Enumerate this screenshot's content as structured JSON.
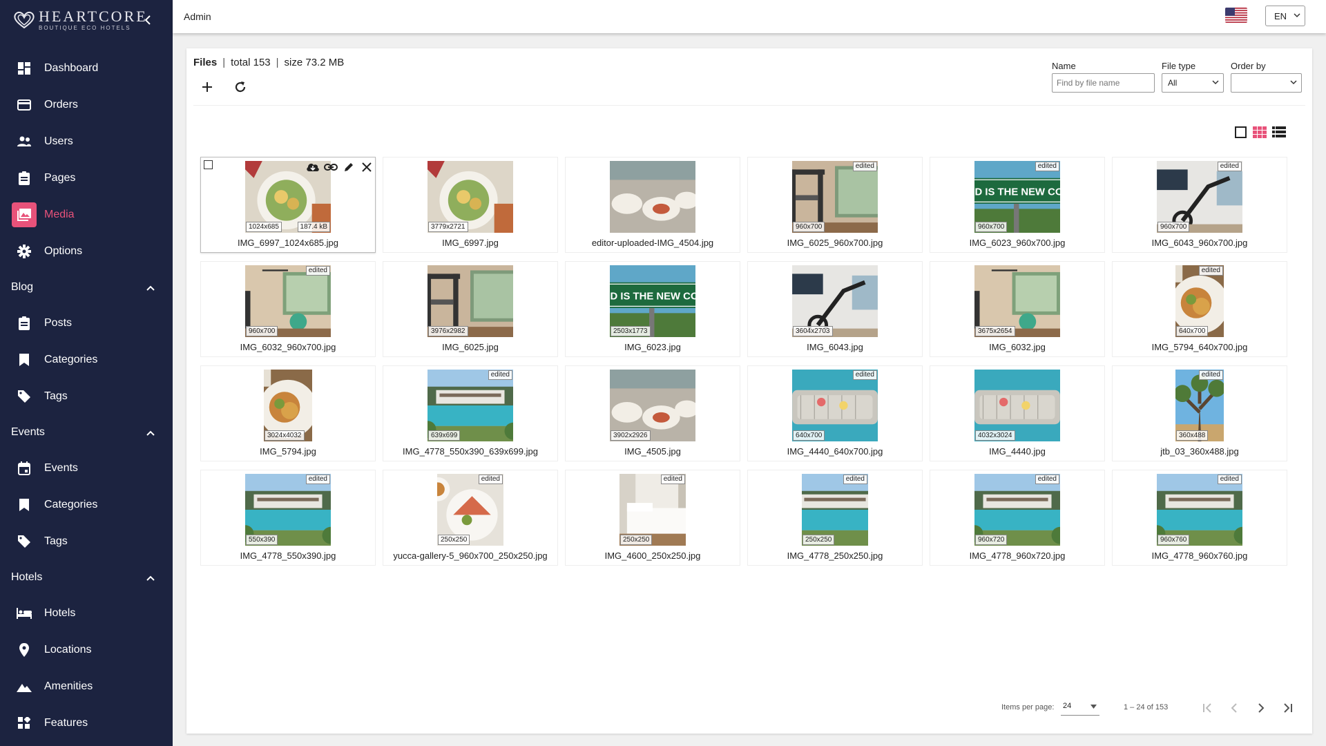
{
  "brand": {
    "name": "HEARTCORE",
    "tagline": "BOUTIQUE ECO HOTELS"
  },
  "topbar": {
    "title": "Admin",
    "language": "EN"
  },
  "sidebar": {
    "items": [
      {
        "label": "Dashboard",
        "icon": "dashboard-icon"
      },
      {
        "label": "Orders",
        "icon": "card-icon"
      },
      {
        "label": "Users",
        "icon": "users-icon"
      },
      {
        "label": "Pages",
        "icon": "page-icon"
      },
      {
        "label": "Media",
        "icon": "image-icon",
        "active": true
      },
      {
        "label": "Options",
        "icon": "gear-icon"
      }
    ],
    "blog": {
      "label": "Blog",
      "items": [
        {
          "label": "Posts"
        },
        {
          "label": "Categories"
        },
        {
          "label": "Tags"
        }
      ]
    },
    "events": {
      "label": "Events",
      "items": [
        {
          "label": "Events"
        },
        {
          "label": "Categories"
        },
        {
          "label": "Tags"
        }
      ]
    },
    "hotels": {
      "label": "Hotels",
      "items": [
        {
          "label": "Hotels"
        },
        {
          "label": "Locations"
        },
        {
          "label": "Amenities"
        },
        {
          "label": "Features"
        }
      ]
    }
  },
  "files": {
    "title": "Files",
    "total": "total 153",
    "sep": "|",
    "size": "size 73.2 MB"
  },
  "filters": {
    "name_label": "Name",
    "name_placeholder": "Find by file name",
    "type_label": "File type",
    "type_value": "All",
    "order_label": "Order by",
    "order_value": ""
  },
  "tiles": [
    {
      "name": "IMG_6997_1024x685.jpg",
      "dim": "1024x685",
      "size": "187.4 kB",
      "edited": false,
      "scene": "food"
    },
    {
      "name": "IMG_6997.jpg",
      "dim": "3779x2721",
      "edited": false,
      "scene": "food"
    },
    {
      "name": "editor-uploaded-IMG_4504.jpg",
      "dim": "",
      "edited": false,
      "scene": "table"
    },
    {
      "name": "IMG_6025_960x700.jpg",
      "dim": "960x700",
      "edited": true,
      "scene": "gym"
    },
    {
      "name": "IMG_6023_960x700.jpg",
      "dim": "960x700",
      "edited": true,
      "scene": "sign"
    },
    {
      "name": "IMG_6043_960x700.jpg",
      "dim": "960x700",
      "edited": true,
      "scene": "bike"
    },
    {
      "name": "IMG_6032_960x700.jpg",
      "dim": "960x700",
      "edited": true,
      "scene": "room"
    },
    {
      "name": "IMG_6025.jpg",
      "dim": "3976x2982",
      "edited": false,
      "scene": "gym"
    },
    {
      "name": "IMG_6023.jpg",
      "dim": "2503x1773",
      "edited": false,
      "scene": "sign"
    },
    {
      "name": "IMG_6043.jpg",
      "dim": "3604x2703",
      "edited": false,
      "scene": "bike"
    },
    {
      "name": "IMG_6032.jpg",
      "dim": "3675x2654",
      "edited": false,
      "scene": "room"
    },
    {
      "name": "IMG_5794_640x700.jpg",
      "dim": "640x700",
      "edited": true,
      "scene": "dish"
    },
    {
      "name": "IMG_5794.jpg",
      "dim": "3024x4032",
      "edited": false,
      "scene": "dish"
    },
    {
      "name": "IMG_4778_550x390_639x699.jpg",
      "dim": "639x699",
      "edited": true,
      "scene": "pool"
    },
    {
      "name": "IMG_4505.jpg",
      "dim": "3902x2926",
      "edited": false,
      "scene": "table"
    },
    {
      "name": "IMG_4440_640x700.jpg",
      "dim": "640x700",
      "edited": true,
      "scene": "tub"
    },
    {
      "name": "IMG_4440.jpg",
      "dim": "4032x3024",
      "edited": false,
      "scene": "tub"
    },
    {
      "name": "jtb_03_360x488.jpg",
      "dim": "360x488",
      "edited": true,
      "scene": "tree"
    },
    {
      "name": "IMG_4778_550x390.jpg",
      "dim": "550x390",
      "edited": true,
      "scene": "pool"
    },
    {
      "name": "yucca-gallery-5_960x700_250x250.jpg",
      "dim": "250x250",
      "edited": true,
      "scene": "plate"
    },
    {
      "name": "IMG_4600_250x250.jpg",
      "dim": "250x250",
      "edited": true,
      "scene": "bed"
    },
    {
      "name": "IMG_4778_250x250.jpg",
      "dim": "250x250",
      "edited": true,
      "scene": "pool"
    },
    {
      "name": "IMG_4778_960x720.jpg",
      "dim": "960x720",
      "edited": true,
      "scene": "pool"
    },
    {
      "name": "IMG_4778_960x760.jpg",
      "dim": "960x760",
      "edited": true,
      "scene": "pool"
    }
  ],
  "edited_label": "edited",
  "pagination": {
    "items_per_page_label": "Items per page:",
    "items_per_page": "24",
    "range": "1 – 24 of 153"
  },
  "colors": {
    "sidebar": "#1c2340",
    "accent": "#e8527a",
    "edited_flag_bg": "#b22234"
  }
}
